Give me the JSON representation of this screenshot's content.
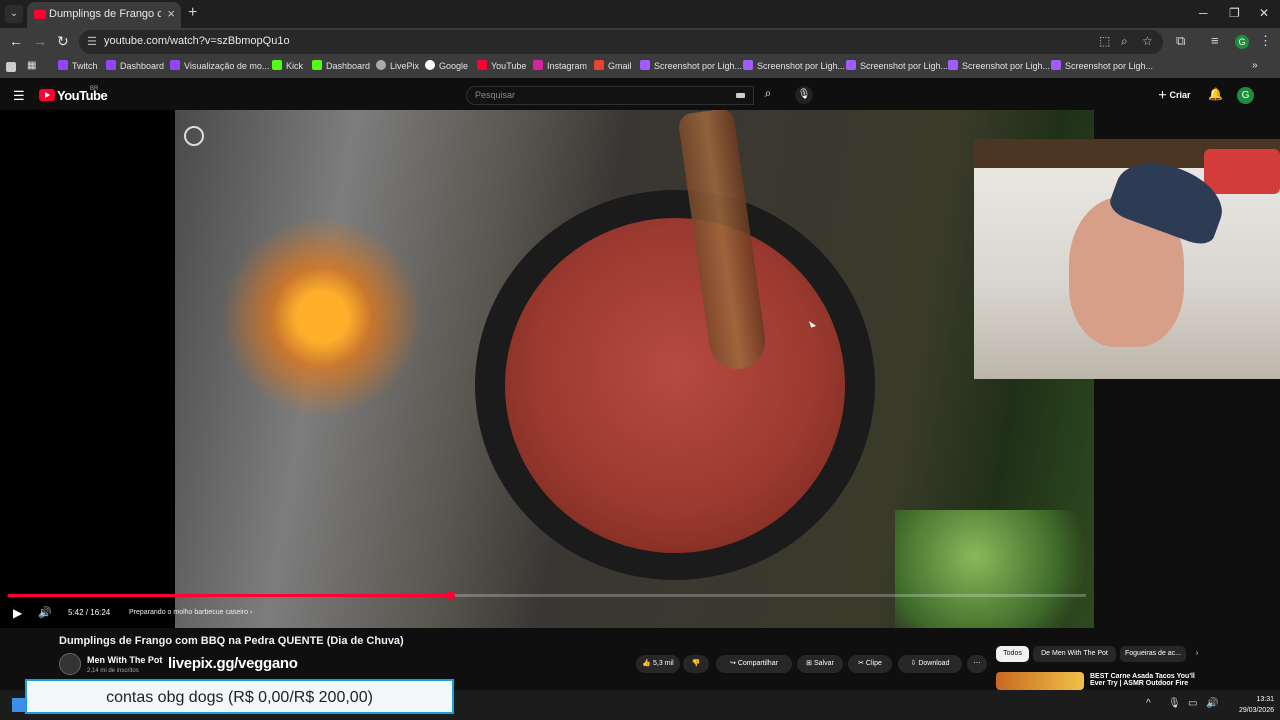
{
  "browser": {
    "tab_title": "Dumplings de Frango com BBQ",
    "url": "youtube.com/watch?v=szBbmopQu1o",
    "bookmarks": [
      "Twitch",
      "Dashboard",
      "Visualização de mo...",
      "Kick",
      "Dashboard",
      "LivePix",
      "Google",
      "YouTube",
      "Instagram",
      "Gmail",
      "Screenshot por Ligh...",
      "Screenshot por Ligh...",
      "Screenshot por Ligh...",
      "Screenshot por Ligh...",
      "Screenshot por Ligh..."
    ],
    "profile_initial": "G"
  },
  "youtube": {
    "logo_text": "YouTube",
    "logo_region": "BR",
    "search_placeholder": "Pesquisar",
    "create_label": "Criar",
    "avatar_initial": "G"
  },
  "player": {
    "time": "5:42 / 16:24",
    "chapter": "Preparando o molho barbecue caseiro",
    "progress": 0.41,
    "buffered": 0.46
  },
  "video": {
    "title": "Dumplings de Frango com BBQ na Pedra QUENTE (Dia de Chuva)",
    "channel": "Men With The Pot",
    "subscribers": "2,14 mi de inscritos",
    "overlay_text": "livepix.gg/veggano",
    "likes": "5,3 mil",
    "share": "Compartilhar",
    "save": "Salvar",
    "clip": "Clipe",
    "download": "Download"
  },
  "recommendations": {
    "chips": [
      "Todos",
      "De Men With The Pot",
      "Fogueiras de ac..."
    ],
    "first_title": "BEST Carne Asada Tacos You'll Ever Try | ASMR Outdoor Fire"
  },
  "overlay_goal": {
    "text": "contas obg dogs (R$ 0,00/R$ 200,00)"
  },
  "taskbar": {
    "time": "13:31",
    "date": "29/03/2026"
  },
  "colors": {
    "youtube_red": "#ff0033",
    "goal_border": "#1aa0d8",
    "background": "#0f0f0f"
  }
}
